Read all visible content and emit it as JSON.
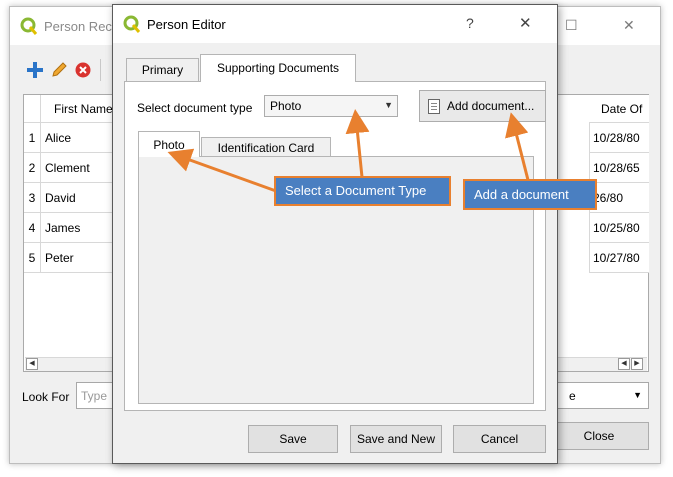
{
  "background_window": {
    "title": "Person Rec",
    "table": {
      "columns": [
        "First Name",
        "Date Of"
      ],
      "rows": [
        {
          "num": "1",
          "first_name": "Alice",
          "date": "10/28/80"
        },
        {
          "num": "2",
          "first_name": "Clement",
          "date": "10/28/65"
        },
        {
          "num": "3",
          "first_name": "David",
          "date": "26/80"
        },
        {
          "num": "4",
          "first_name": "James",
          "date": "10/25/80"
        },
        {
          "num": "5",
          "first_name": "Peter",
          "date": "10/27/80"
        }
      ]
    },
    "look_for_label": "Look For",
    "look_for_placeholder": "Type",
    "select_value": "e",
    "close_label": "Close"
  },
  "dialog": {
    "title": "Person Editor",
    "help_glyph": "?",
    "close_glyph": "✕",
    "tabs": [
      "Primary",
      "Supporting Documents"
    ],
    "doc_type_label": "Select document type",
    "doc_type_value": "Photo",
    "add_document_label": "Add document...",
    "subtabs": [
      "Photo",
      "Identification Card"
    ],
    "buttons": {
      "save": "Save",
      "save_new": "Save and New",
      "cancel": "Cancel"
    }
  },
  "annotations": {
    "select_type": "Select a Document  Type",
    "add_document": "Add a document"
  },
  "colors": {
    "callout_fill": "#4a7fc1",
    "callout_border": "#e8802f",
    "arrow": "#e8802f",
    "qgis_green": "#8ab833",
    "add_icon": "#2a74c8",
    "delete_icon": "#d9332f"
  }
}
